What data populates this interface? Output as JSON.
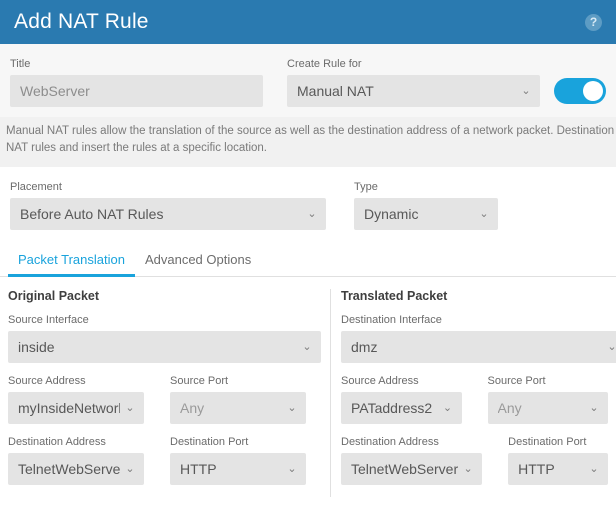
{
  "header": {
    "title": "Add NAT Rule",
    "help_icon": "help-circle-icon",
    "help_glyph": "?"
  },
  "top_form": {
    "title_label": "Title",
    "title_value": "WebServer",
    "title_placeholder": "Title",
    "create_rule_for_label": "Create Rule for",
    "create_rule_for_value": "Manual NAT",
    "enable_toggle_state": "on"
  },
  "description": "Manual NAT rules allow the translation of the source as well as the destination address of a network packet. Destination and port translation are optional. You can place manual NAT rules either before or after Auto NAT rules and insert the rules at a specific location.",
  "rule_options": {
    "placement_label": "Placement",
    "placement_value": "Before Auto NAT Rules",
    "type_label": "Type",
    "type_value": "Dynamic"
  },
  "tabs": [
    {
      "label": "Packet Translation",
      "active": true
    },
    {
      "label": "Advanced Options",
      "active": false
    }
  ],
  "original_packet": {
    "section_title": "Original Packet",
    "source_interface_label": "Source Interface",
    "source_interface_value": "inside",
    "source_address_label": "Source Address",
    "source_address_value": "myInsideNetwork",
    "source_port_label": "Source Port",
    "source_port_value": "Any",
    "destination_address_label": "Destination Address",
    "destination_address_value": "TelnetWebServer",
    "destination_port_label": "Destination Port",
    "destination_port_value": "HTTP"
  },
  "translated_packet": {
    "section_title": "Translated Packet",
    "destination_interface_label": "Destination Interface",
    "destination_interface_value": "dmz",
    "source_address_label": "Source Address",
    "source_address_value": "PATaddress2",
    "source_port_label": "Source Port",
    "source_port_value": "Any",
    "destination_address_label": "Destination Address",
    "destination_address_value": "TelnetWebServer",
    "destination_port_label": "Destination Port",
    "destination_port_value": "HTTP"
  },
  "icons": {
    "caret": "chevron-down-icon",
    "caret_glyph": "⌄"
  },
  "colors": {
    "header_blue": "#2a7ab0",
    "accent_blue": "#19a3dc",
    "field_gray": "#e4e4e4",
    "band_gray": "#f1f1f1"
  }
}
